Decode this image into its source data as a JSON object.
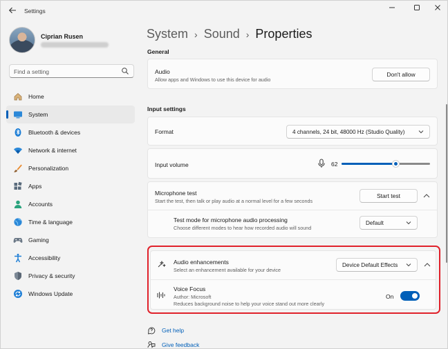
{
  "window": {
    "title": "Settings"
  },
  "profile": {
    "name": "Ciprian Rusen"
  },
  "search": {
    "placeholder": "Find a setting"
  },
  "nav": {
    "items": [
      {
        "label": "Home",
        "icon": "home-icon"
      },
      {
        "label": "System",
        "icon": "system-icon",
        "active": true
      },
      {
        "label": "Bluetooth & devices",
        "icon": "bluetooth-icon"
      },
      {
        "label": "Network & internet",
        "icon": "wifi-icon"
      },
      {
        "label": "Personalization",
        "icon": "brush-icon"
      },
      {
        "label": "Apps",
        "icon": "apps-icon"
      },
      {
        "label": "Accounts",
        "icon": "accounts-icon"
      },
      {
        "label": "Time & language",
        "icon": "globe-icon"
      },
      {
        "label": "Gaming",
        "icon": "gamepad-icon"
      },
      {
        "label": "Accessibility",
        "icon": "accessibility-icon"
      },
      {
        "label": "Privacy & security",
        "icon": "shield-icon"
      },
      {
        "label": "Windows Update",
        "icon": "update-icon"
      }
    ]
  },
  "breadcrumb": {
    "parts": [
      "System",
      "Sound",
      "Properties"
    ],
    "separator": "›"
  },
  "general": {
    "heading": "General",
    "audio": {
      "title": "Audio",
      "desc": "Allow apps and Windows to use this device for audio",
      "button": "Don't allow"
    }
  },
  "input": {
    "heading": "Input settings",
    "format": {
      "title": "Format",
      "value": "4 channels, 24 bit, 48000 Hz (Studio Quality)"
    },
    "volume": {
      "title": "Input volume",
      "value": "62",
      "level": 62
    },
    "mic_test": {
      "title": "Microphone test",
      "desc": "Start the test, then talk or play audio at a normal level for a few seconds",
      "button": "Start test",
      "test_mode": {
        "title": "Test mode for microphone audio processing",
        "desc": "Choose different modes to hear how recorded audio will sound",
        "value": "Default"
      }
    },
    "enhancements": {
      "title": "Audio enhancements",
      "desc": "Select an enhancement available for your device",
      "value": "Device Default Effects",
      "voice_focus": {
        "title": "Voice Focus",
        "author": "Author: Microsoft",
        "desc": "Reduces background noise to help your voice stand out more clearly",
        "toggle_label": "On",
        "on": true
      }
    }
  },
  "links": {
    "help": "Get help",
    "feedback": "Give feedback"
  },
  "colors": {
    "accent": "#005fb8",
    "highlight": "#e0202a"
  }
}
